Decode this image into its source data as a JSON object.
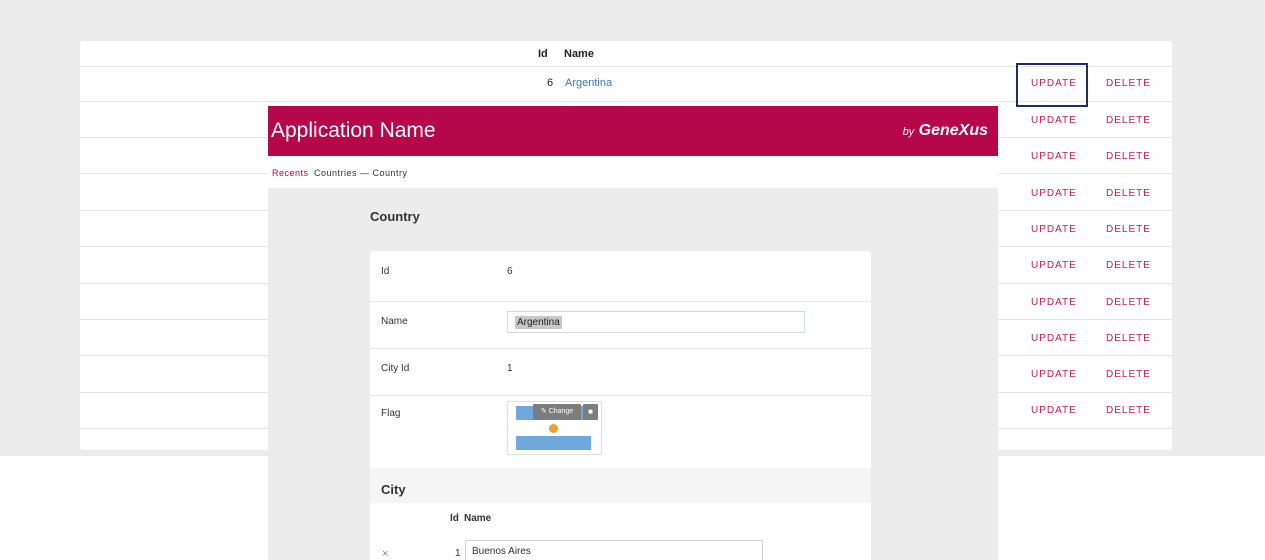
{
  "list": {
    "col_id": "Id",
    "col_name": "Name",
    "first_row": {
      "id": "6",
      "name": "Argentina"
    },
    "update_label": "UPDATE",
    "delete_label": "DELETE",
    "action_rows": 10
  },
  "app": {
    "title": "Application Name",
    "brand_by": "by",
    "brand_name": "GeneXus",
    "breadcrumb_recents": "Recents",
    "breadcrumb_current": "Countries — Country",
    "section_title": "Country",
    "fields": {
      "id_label": "Id",
      "id_value": "6",
      "name_label": "Name",
      "name_value": "Argentina",
      "city_id_label": "City Id",
      "city_id_value": "1",
      "flag_label": "Flag",
      "change_label": "Change"
    },
    "city": {
      "title": "City",
      "col_id": "Id",
      "col_name": "Name",
      "row": {
        "remove": "×",
        "id": "1",
        "name": "Buenos Aires"
      }
    }
  },
  "colors": {
    "header": "#b5074a",
    "action": "#c0204f",
    "link": "#3a7ab8",
    "focus": "#1f2d6b"
  }
}
